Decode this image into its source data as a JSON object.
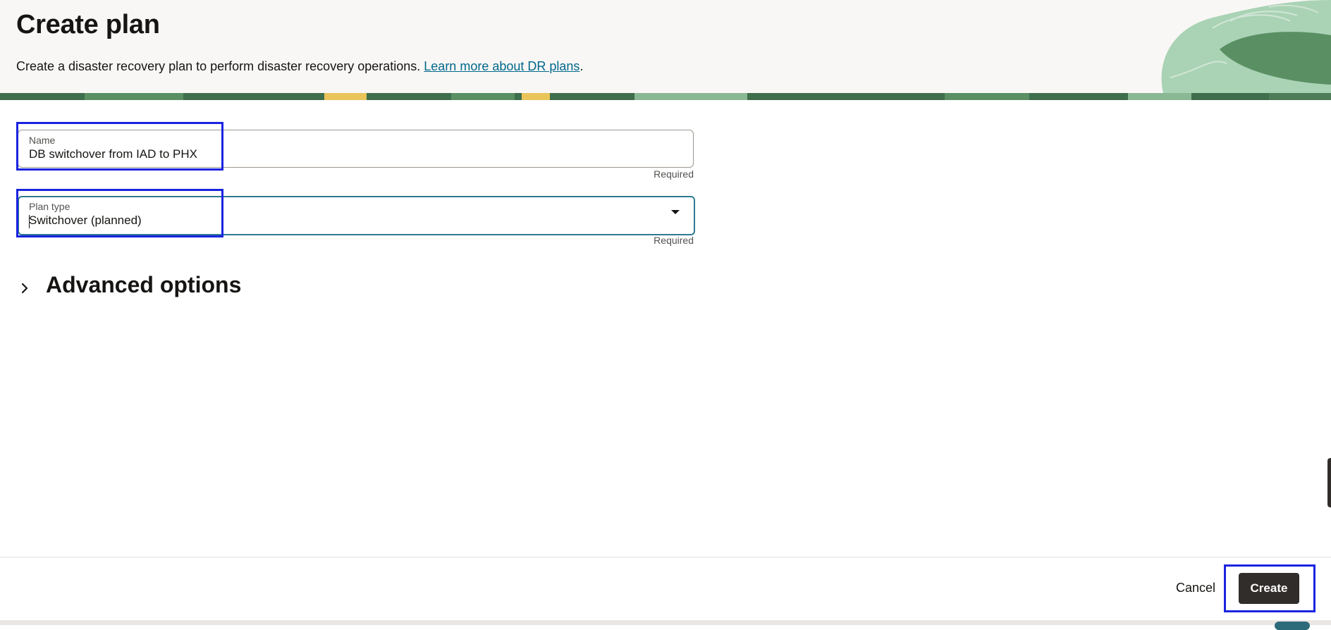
{
  "header": {
    "title": "Create plan",
    "description": "Create a disaster recovery plan to perform disaster recovery operations.",
    "learn_more_link": "Learn more about DR plans",
    "description_suffix": "."
  },
  "form": {
    "name": {
      "label": "Name",
      "value": "DB switchover from IAD to PHX",
      "help": "Required"
    },
    "plan_type": {
      "label": "Plan type",
      "value": "Switchover (planned)",
      "help": "Required",
      "icon": "chevron-down-icon"
    }
  },
  "advanced": {
    "title": "Advanced options",
    "icon": "chevron-right-icon"
  },
  "footer": {
    "cancel_label": "Cancel",
    "create_label": "Create"
  },
  "colors": {
    "header_bg": "#f9f7f5",
    "link": "#00688c",
    "focus_border": "#2e7a93",
    "primary_button": "#312d2a",
    "highlight_box": "#1a24e0",
    "deco_green": "#5a8f63"
  }
}
